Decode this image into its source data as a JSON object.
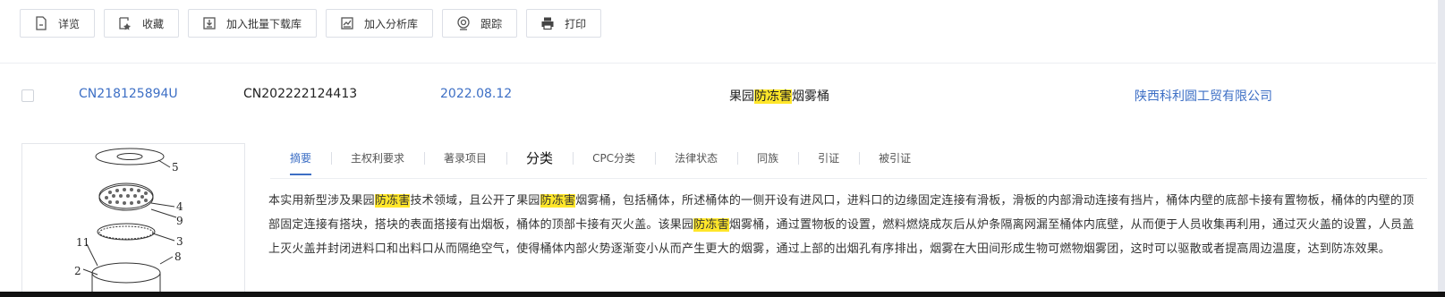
{
  "toolbar": {
    "buttons": [
      {
        "label": "详览",
        "icon": "document-icon"
      },
      {
        "label": "收藏",
        "icon": "bookmark-add-icon"
      },
      {
        "label": "加入批量下载库",
        "icon": "download-box-icon"
      },
      {
        "label": "加入分析库",
        "icon": "chart-analysis-icon"
      },
      {
        "label": "跟踪",
        "icon": "radar-icon"
      },
      {
        "label": "打印",
        "icon": "printer-icon"
      }
    ]
  },
  "record": {
    "pub_number": "CN218125894U",
    "app_number": "CN202222124413",
    "date": "2022.08.12",
    "title_prefix": "果园",
    "title_highlight": "防冻害",
    "title_suffix": "烟雾桶",
    "applicant": "陕西科利圆工贸有限公司"
  },
  "tabs": [
    {
      "label": "摘要",
      "active": true
    },
    {
      "label": "主权利要求"
    },
    {
      "label": "著录项目"
    },
    {
      "label": "分类"
    },
    {
      "label": "CPC分类"
    },
    {
      "label": "法律状态"
    },
    {
      "label": "同族"
    },
    {
      "label": "引证"
    },
    {
      "label": "被引证"
    }
  ],
  "abstract": {
    "p1": "本实用新型涉及果园",
    "h1": "防冻害",
    "p2": "技术领域，且公开了果园",
    "h2": "防冻害",
    "p3": "烟雾桶，包括桶体，所述桶体的一侧开设有进风口，进料口的边缘固定连接有滑板，滑板的内部滑动连接有挡片，桶体内壁的底部卡接有置物板，桶体的内壁的顶部固定连接有搭块，搭块的表面搭接有出烟板，桶体的顶部卡接有灭火盖。该果园",
    "h3": "防冻害",
    "p4": "烟雾桶，通过置物板的设置，燃料燃烧成灰后从炉条隔离网漏至桶体内底壁，从而便于人员收集再利用，通过灭火盖的设置，人员盖上灭火盖并封闭进料口和出料口从而隔绝空气，使得桶体内部火势逐渐变小从而产生更大的烟雾，通过上部的出烟孔有序排出，烟雾在大田间形成生物可燃物烟雾团，这时可以驱散或者提高周边温度，达到防冻效果。"
  },
  "drawing": {
    "labels": [
      "5",
      "4",
      "9",
      "3",
      "11",
      "8",
      "2"
    ]
  }
}
